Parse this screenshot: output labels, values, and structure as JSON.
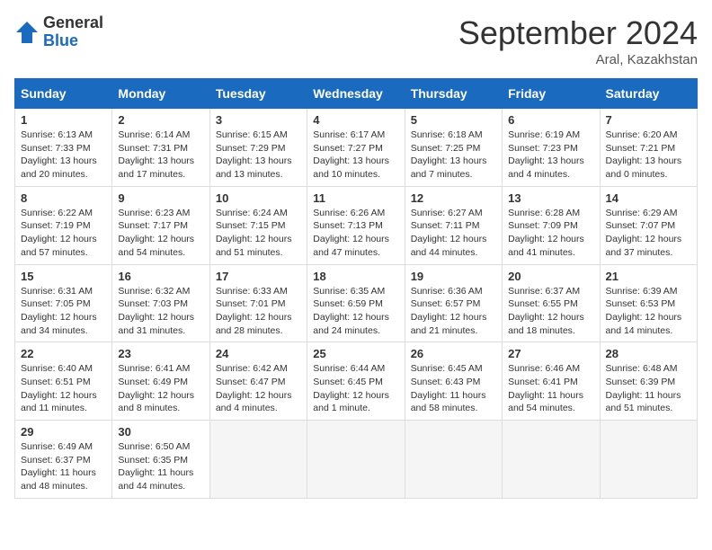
{
  "header": {
    "logo_general": "General",
    "logo_blue": "Blue",
    "month_title": "September 2024",
    "location": "Aral, Kazakhstan"
  },
  "columns": [
    "Sunday",
    "Monday",
    "Tuesday",
    "Wednesday",
    "Thursday",
    "Friday",
    "Saturday"
  ],
  "weeks": [
    [
      {
        "day": "1",
        "sunrise": "6:13 AM",
        "sunset": "7:33 PM",
        "daylight": "13 hours and 20 minutes."
      },
      {
        "day": "2",
        "sunrise": "6:14 AM",
        "sunset": "7:31 PM",
        "daylight": "13 hours and 17 minutes."
      },
      {
        "day": "3",
        "sunrise": "6:15 AM",
        "sunset": "7:29 PM",
        "daylight": "13 hours and 13 minutes."
      },
      {
        "day": "4",
        "sunrise": "6:17 AM",
        "sunset": "7:27 PM",
        "daylight": "13 hours and 10 minutes."
      },
      {
        "day": "5",
        "sunrise": "6:18 AM",
        "sunset": "7:25 PM",
        "daylight": "13 hours and 7 minutes."
      },
      {
        "day": "6",
        "sunrise": "6:19 AM",
        "sunset": "7:23 PM",
        "daylight": "13 hours and 4 minutes."
      },
      {
        "day": "7",
        "sunrise": "6:20 AM",
        "sunset": "7:21 PM",
        "daylight": "13 hours and 0 minutes."
      }
    ],
    [
      {
        "day": "8",
        "sunrise": "6:22 AM",
        "sunset": "7:19 PM",
        "daylight": "12 hours and 57 minutes."
      },
      {
        "day": "9",
        "sunrise": "6:23 AM",
        "sunset": "7:17 PM",
        "daylight": "12 hours and 54 minutes."
      },
      {
        "day": "10",
        "sunrise": "6:24 AM",
        "sunset": "7:15 PM",
        "daylight": "12 hours and 51 minutes."
      },
      {
        "day": "11",
        "sunrise": "6:26 AM",
        "sunset": "7:13 PM",
        "daylight": "12 hours and 47 minutes."
      },
      {
        "day": "12",
        "sunrise": "6:27 AM",
        "sunset": "7:11 PM",
        "daylight": "12 hours and 44 minutes."
      },
      {
        "day": "13",
        "sunrise": "6:28 AM",
        "sunset": "7:09 PM",
        "daylight": "12 hours and 41 minutes."
      },
      {
        "day": "14",
        "sunrise": "6:29 AM",
        "sunset": "7:07 PM",
        "daylight": "12 hours and 37 minutes."
      }
    ],
    [
      {
        "day": "15",
        "sunrise": "6:31 AM",
        "sunset": "7:05 PM",
        "daylight": "12 hours and 34 minutes."
      },
      {
        "day": "16",
        "sunrise": "6:32 AM",
        "sunset": "7:03 PM",
        "daylight": "12 hours and 31 minutes."
      },
      {
        "day": "17",
        "sunrise": "6:33 AM",
        "sunset": "7:01 PM",
        "daylight": "12 hours and 28 minutes."
      },
      {
        "day": "18",
        "sunrise": "6:35 AM",
        "sunset": "6:59 PM",
        "daylight": "12 hours and 24 minutes."
      },
      {
        "day": "19",
        "sunrise": "6:36 AM",
        "sunset": "6:57 PM",
        "daylight": "12 hours and 21 minutes."
      },
      {
        "day": "20",
        "sunrise": "6:37 AM",
        "sunset": "6:55 PM",
        "daylight": "12 hours and 18 minutes."
      },
      {
        "day": "21",
        "sunrise": "6:39 AM",
        "sunset": "6:53 PM",
        "daylight": "12 hours and 14 minutes."
      }
    ],
    [
      {
        "day": "22",
        "sunrise": "6:40 AM",
        "sunset": "6:51 PM",
        "daylight": "12 hours and 11 minutes."
      },
      {
        "day": "23",
        "sunrise": "6:41 AM",
        "sunset": "6:49 PM",
        "daylight": "12 hours and 8 minutes."
      },
      {
        "day": "24",
        "sunrise": "6:42 AM",
        "sunset": "6:47 PM",
        "daylight": "12 hours and 4 minutes."
      },
      {
        "day": "25",
        "sunrise": "6:44 AM",
        "sunset": "6:45 PM",
        "daylight": "12 hours and 1 minute."
      },
      {
        "day": "26",
        "sunrise": "6:45 AM",
        "sunset": "6:43 PM",
        "daylight": "11 hours and 58 minutes."
      },
      {
        "day": "27",
        "sunrise": "6:46 AM",
        "sunset": "6:41 PM",
        "daylight": "11 hours and 54 minutes."
      },
      {
        "day": "28",
        "sunrise": "6:48 AM",
        "sunset": "6:39 PM",
        "daylight": "11 hours and 51 minutes."
      }
    ],
    [
      {
        "day": "29",
        "sunrise": "6:49 AM",
        "sunset": "6:37 PM",
        "daylight": "11 hours and 48 minutes."
      },
      {
        "day": "30",
        "sunrise": "6:50 AM",
        "sunset": "6:35 PM",
        "daylight": "11 hours and 44 minutes."
      },
      null,
      null,
      null,
      null,
      null
    ]
  ]
}
